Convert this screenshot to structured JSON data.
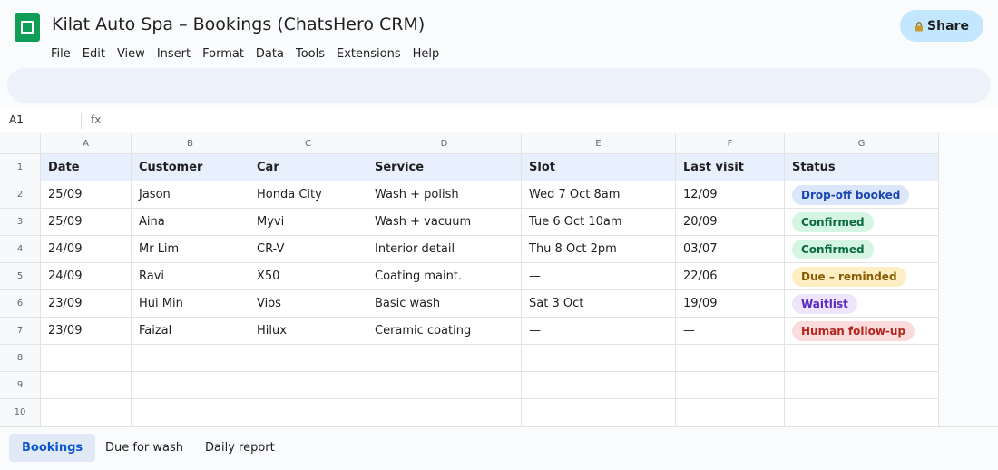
{
  "app": {
    "title": "Kilat Auto Spa – Bookings (ChatsHero CRM)",
    "share_label": "Share",
    "logo_icon": "sheets-logo-icon",
    "accent": "#0f9d58"
  },
  "menu": [
    "File",
    "Edit",
    "View",
    "Insert",
    "Format",
    "Data",
    "Tools",
    "Extensions",
    "Help"
  ],
  "formula": {
    "cell_ref": "A1",
    "fx": "fx",
    "value": ""
  },
  "columns": [
    "A",
    "B",
    "C",
    "D",
    "E",
    "F",
    "G"
  ],
  "row_numbers": [
    "1",
    "2",
    "3",
    "4",
    "5",
    "6",
    "7",
    "8",
    "9",
    "10"
  ],
  "headers": [
    "Date",
    "Customer",
    "Car",
    "Service",
    "Slot",
    "Last visit",
    "Status"
  ],
  "rows": [
    [
      "25/09",
      "Jason",
      "Honda City",
      "Wash + polish",
      "Wed 7 Oct 8am",
      "12/09",
      "Drop-off booked"
    ],
    [
      "25/09",
      "Aina",
      "Myvi",
      "Wash + vacuum",
      "Tue 6 Oct 10am",
      "20/09",
      "Confirmed"
    ],
    [
      "24/09",
      "Mr Lim",
      "CR-V",
      "Interior detail",
      "Thu 8 Oct 2pm",
      "03/07",
      "Confirmed"
    ],
    [
      "24/09",
      "Ravi",
      "X50",
      "Coating maint.",
      "—",
      "22/06",
      "Due – reminded"
    ],
    [
      "23/09",
      "Hui Min",
      "Vios",
      "Basic wash",
      "Sat 3 Oct",
      "19/09",
      "Waitlist"
    ],
    [
      "23/09",
      "Faizal",
      "Hilux",
      "Ceramic coating",
      "—",
      "—",
      "Human follow-up"
    ]
  ],
  "status_colors": {
    "Drop-off booked": {
      "bg": "#dbe6fb",
      "fg": "#1a47b0"
    },
    "Confirmed": {
      "bg": "#d4f5e2",
      "fg": "#0c6b3e"
    },
    "Due – reminded": {
      "bg": "#fdefc3",
      "fg": "#8a5a00"
    },
    "Waitlist": {
      "bg": "#ece5fb",
      "fg": "#5b2bbd"
    },
    "Human follow-up": {
      "bg": "#fbdcdc",
      "fg": "#b3261e"
    }
  },
  "sheet_tabs": [
    {
      "label": "Bookings",
      "active": true
    },
    {
      "label": "Due for wash",
      "active": false
    },
    {
      "label": "Daily report",
      "active": false
    }
  ]
}
